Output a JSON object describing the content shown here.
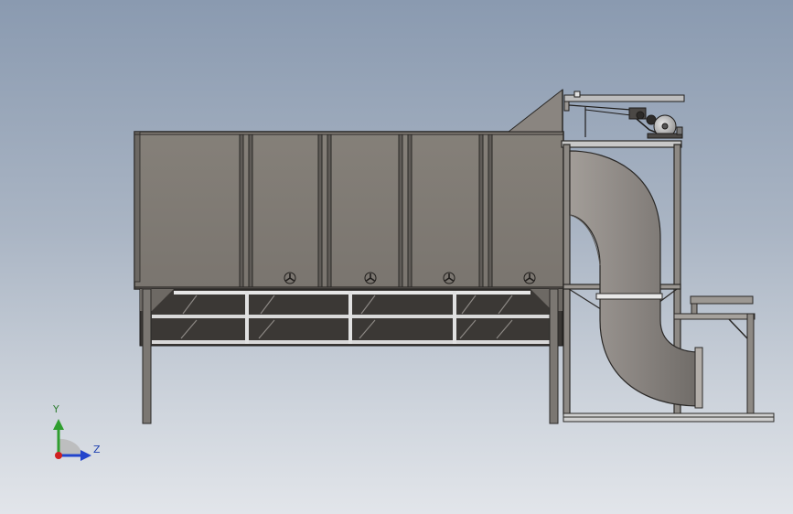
{
  "view": {
    "background_top": "#8a9ab0",
    "background_bottom": "#e2e5ea"
  },
  "model": {
    "body_color": "#807b76",
    "frame_color": "#56534f",
    "dark_color": "#3d3a37",
    "chute_color": "#8e8985",
    "outline_color": "#2a2826"
  },
  "triad": {
    "y_label": "Y",
    "z_label": "Z",
    "y_color": "#2f9e2f",
    "z_color": "#2244cc",
    "origin_color": "#d02020"
  }
}
